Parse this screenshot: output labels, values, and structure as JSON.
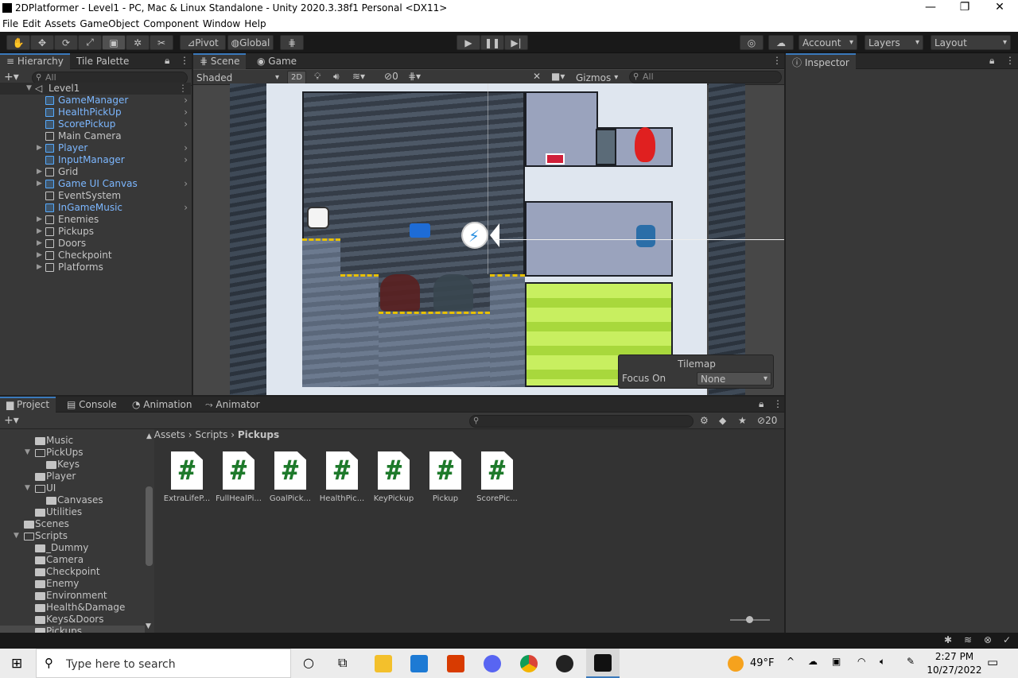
{
  "window": {
    "title": "2DPlatformer - Level1 - PC, Mac & Linux Standalone - Unity 2020.3.38f1 Personal <DX11>",
    "minimize": "—",
    "restore": "❐",
    "close": "✕"
  },
  "menu": [
    "File",
    "Edit",
    "Assets",
    "GameObject",
    "Component",
    "Window",
    "Help"
  ],
  "toolbar": {
    "pivot": "Pivot",
    "global": "Global",
    "account": "Account",
    "layers": "Layers",
    "layout": "Layout"
  },
  "hierarchy": {
    "tab": "Hierarchy",
    "tab2": "Tile Palette",
    "search_placeholder": "All",
    "scene": "Level1",
    "items": [
      {
        "label": "GameManager",
        "prefab": true
      },
      {
        "label": "HealthPickUp",
        "prefab": true
      },
      {
        "label": "ScorePickup",
        "prefab": true
      },
      {
        "label": "Main Camera",
        "prefab": false
      },
      {
        "label": "Player",
        "prefab": true
      },
      {
        "label": "InputManager",
        "prefab": true
      },
      {
        "label": "Grid",
        "prefab": false
      },
      {
        "label": "Game UI Canvas",
        "prefab": true
      },
      {
        "label": "EventSystem",
        "prefab": false
      },
      {
        "label": "InGameMusic",
        "prefab": true
      },
      {
        "label": "Enemies",
        "prefab": false
      },
      {
        "label": "Pickups",
        "prefab": false
      },
      {
        "label": "Doors",
        "prefab": false
      },
      {
        "label": "Checkpoint",
        "prefab": false
      },
      {
        "label": "Platforms",
        "prefab": false
      }
    ]
  },
  "scene": {
    "tab": "Scene",
    "tab2": "Game",
    "shading": "Shaded",
    "mode2d": "2D",
    "hidden_count": "0",
    "gizmos": "Gizmos",
    "search_placeholder": "All",
    "overlay_title": "Tilemap",
    "focus_label": "Focus On",
    "focus_value": "None"
  },
  "inspector": {
    "tab": "Inspector"
  },
  "project": {
    "tabs": [
      "Project",
      "Console",
      "Animation",
      "Animator"
    ],
    "hidden_count": "20",
    "breadcrumb": [
      "Assets",
      "Scripts",
      "Pickups"
    ],
    "tree": [
      "Music",
      "PickUps",
      "Keys",
      "Player",
      "UI",
      "Canvases",
      "Utilities",
      "Scenes",
      "Scripts",
      "_Dummy",
      "Camera",
      "Checkpoint",
      "Enemy",
      "Environment",
      "Health&Damage",
      "Keys&Doors",
      "Pickups"
    ],
    "assets": [
      "ExtraLifeP...",
      "FullHealPi...",
      "GoalPick...",
      "HealthPic...",
      "KeyPickup",
      "Pickup",
      "ScorePic..."
    ]
  },
  "taskbar": {
    "search": "Type here to search",
    "weather": "49°F",
    "time": "2:27 PM",
    "date": "10/27/2022"
  }
}
